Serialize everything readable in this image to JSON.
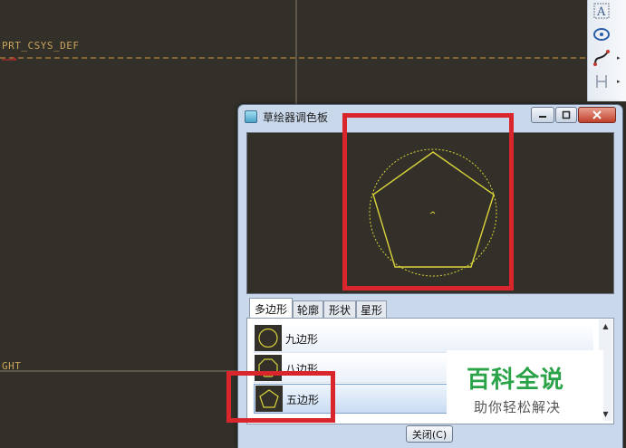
{
  "background": {
    "csys_label": "PRT_CSYS_DEF",
    "left_label": "GHT"
  },
  "colors": {
    "canvas": "#332f29",
    "sketch_yellow": "#d9d43a",
    "datum_orange": "#d19a45",
    "annotation_red": "#d9262c",
    "watermark_green": "#2aa348"
  },
  "toolbar": {
    "icons": [
      "text-icon",
      "ellipse-icon",
      "spline-icon",
      "dimension-icon"
    ]
  },
  "dialog": {
    "title": "草绘器调色板",
    "tabs": [
      {
        "label": "多边形"
      },
      {
        "label": "轮廓"
      },
      {
        "label": "形状"
      },
      {
        "label": "星形"
      }
    ],
    "active_tab": "多边形",
    "items": [
      {
        "label": "九边形"
      },
      {
        "label": "八边形"
      },
      {
        "label": "五边形"
      }
    ],
    "selected_item": "五边形",
    "close_label": "关闭(C)"
  },
  "watermark": {
    "title": "百科全说",
    "subtitle": "助你轻松解决"
  }
}
